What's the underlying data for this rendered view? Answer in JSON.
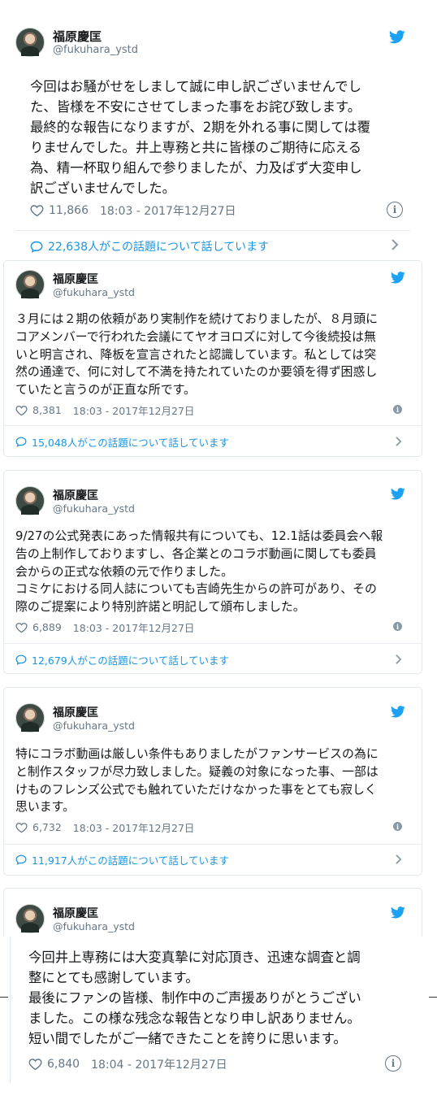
{
  "user": {
    "name": "福原慶匡",
    "handle": "@fukuhara_ystd"
  },
  "icons": {
    "logo": "twitter-bird-icon",
    "like": "heart-icon",
    "info": "info-icon",
    "conversation": "speech-bubble-icon",
    "chevron": "chevron-right-icon"
  },
  "colors": {
    "accent": "#1da1f2",
    "link": "#1b95e0",
    "muted": "#657786",
    "border": "#e1e8ed"
  },
  "tweets": [
    {
      "lines": [
        "今回はお騒がせをしまして誠に申し訳ございませんでし",
        "た、皆様を不安にさせてしまった事をお詫び致します。",
        "最終的な報告になりますが、2期を外れる事に関しては覆",
        "りませんでした。井上専務と共に皆様のご期待に応える",
        "為、精一杯取り組んで参りましたが、力及ばず大変申し",
        "訳ございませんでした。"
      ],
      "likes": "11,866",
      "timestamp": "18:03 - 2017年12月27日",
      "conversation": "22,638人がこの話題について話しています"
    },
    {
      "lines": [
        "３月には２期の依頼があり実制作を続けておりましたが、８月頭に",
        "コアメンバーで行われた会議にてヤオヨロズに対して今後続投は無",
        "いと明言され、降板を宣言されたと認識しています。私としては突",
        "然の通達で、何に対して不満を持たれていたのか要領を得ず困惑し",
        "ていたと言うのが正直な所です。"
      ],
      "likes": "8,381",
      "timestamp": "18:03 - 2017年12月27日",
      "conversation": "15,048人がこの話題について話しています"
    },
    {
      "lines": [
        "9/27の公式発表にあった情報共有についても、12.1話は委員会へ報",
        "告の上制作しておりますし、各企業とのコラボ動画に関しても委員",
        "会からの正式な依頼の元で作りました。",
        "コミケにおける同人誌についても吉崎先生からの許可があり、その",
        "際のご提案により特別許諾と明記して頒布しました。"
      ],
      "likes": "6,889",
      "timestamp": "18:03 - 2017年12月27日",
      "conversation": "12,679人がこの話題について話しています"
    },
    {
      "lines": [
        "特にコラボ動画は厳しい条件もありましたがファンサービスの為に",
        "と制作スタッフが尽力致しました。疑義の対象になった事、一部は",
        "けものフレンズ公式でも触れていただけなかった事をとても寂しく",
        "思います。"
      ],
      "likes": "6,732",
      "timestamp": "18:03 - 2017年12月27日",
      "conversation": "11,917人がこの話題について話しています"
    },
    {
      "lines": [
        "今回井上専務には大変真摯に対応頂き、迅速な調査と調",
        "整にとても感謝しています。",
        "最後にファンの皆様、制作中のご声援ありがとうござい",
        "ました。この様な残念な報告となり申し訳ありません。",
        "短い間でしたがご一緒できたことを誇りに思います。"
      ],
      "likes": "6,840",
      "timestamp": "18:04 - 2017年12月27日"
    }
  ]
}
